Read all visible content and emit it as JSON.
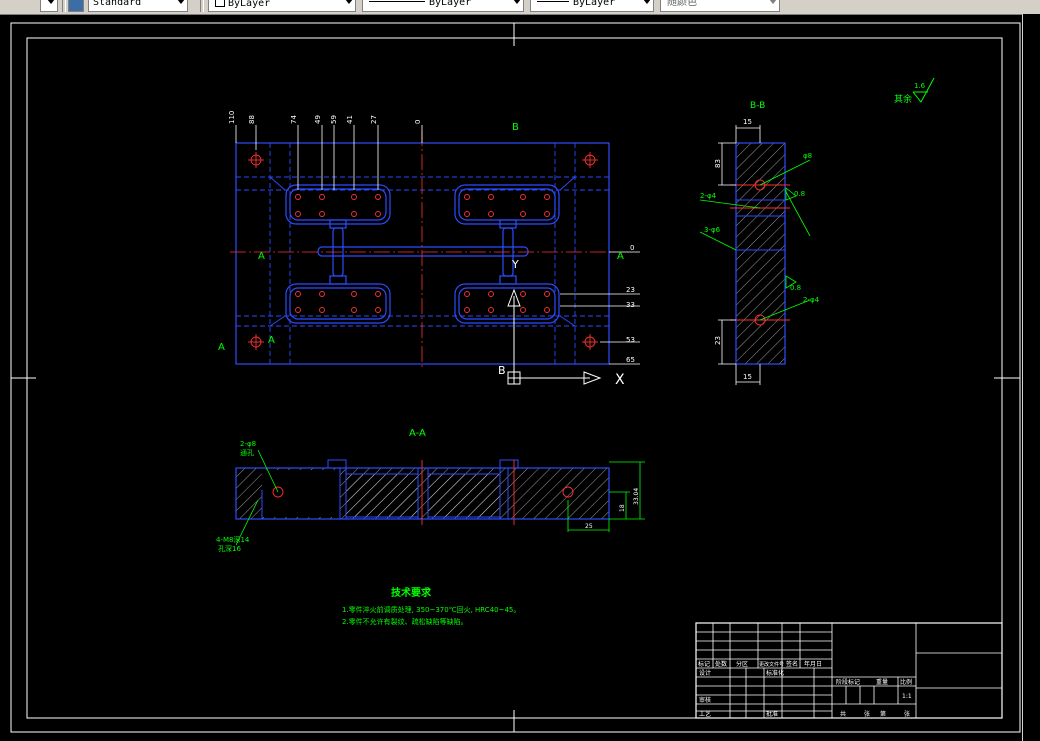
{
  "toolbar": {
    "text_style": "Standard",
    "layer": "ByLayer",
    "linetype": "ByLayer",
    "lineweight": "ByLayer",
    "color": "随颜色"
  },
  "drawing": {
    "section_bb_label": "B-B",
    "section_aa_label": "A-A",
    "view_b_label": "B",
    "view_b_label_top": "B",
    "cut_a_left": "A",
    "cut_a_right": "A",
    "cut_a_bottom": "A",
    "cut_a_bottom2": "A",
    "roughness_note": "其余",
    "roughness_value": "1.6",
    "ucs_x": "X",
    "ucs_y": "Y",
    "dim_top": [
      "110",
      "88",
      "74",
      "49",
      "59",
      "41",
      "27",
      "0"
    ],
    "dim_right": [
      "0",
      "23",
      "33",
      "53",
      "65"
    ],
    "bb_dims": {
      "top": "15",
      "left": "83",
      "bottom": "15",
      "lower": "23",
      "d1": "φ8",
      "d2": "2-φ4",
      "d3": "3-φ6",
      "d4": "2-φ4",
      "d5": "0.8",
      "d6": "0.8"
    },
    "aa_dims": {
      "height": "33.04",
      "h2": "18",
      "w": "25",
      "note1": "2-φ8",
      "note1b": "通孔",
      "note2": "4-M8深14",
      "note2b": "孔深16"
    },
    "tech_title": "技术要求",
    "tech_line1": "1.零件淬火前调质处理, 350~370℃回火, HRC40~45。",
    "tech_line2": "2.零件不允许有裂纹、疏松缺陷等缺陷。",
    "title_block": {
      "row_labels": [
        "标记",
        "处数",
        "分区",
        "更改文件号",
        "签名",
        "年月日"
      ],
      "design": "设计",
      "standard": "标准化",
      "audit": "审核",
      "process": "工艺",
      "approve": "批准",
      "stage": "阶段标记",
      "weight": "重量",
      "scale_label": "比例",
      "scale": "1:1",
      "sheets": "共",
      "sheet": "张",
      "page": "第",
      "page2": "张"
    }
  }
}
